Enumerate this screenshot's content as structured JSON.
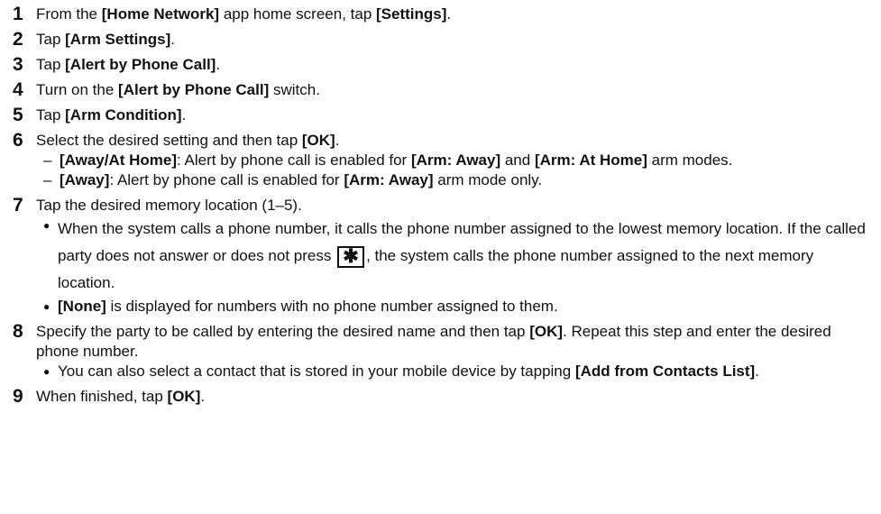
{
  "steps": [
    {
      "num": "1",
      "parts": [
        "From the ",
        "[Home Network]",
        " app home screen, tap ",
        "[Settings]",
        "."
      ]
    },
    {
      "num": "2",
      "parts": [
        "Tap ",
        "[Arm Settings]",
        "."
      ]
    },
    {
      "num": "3",
      "parts": [
        "Tap ",
        "[Alert by Phone Call]",
        "."
      ]
    },
    {
      "num": "4",
      "parts": [
        "Turn on the ",
        "[Alert by Phone Call]",
        " switch."
      ]
    },
    {
      "num": "5",
      "parts": [
        "Tap ",
        "[Arm Condition]",
        "."
      ]
    },
    {
      "num": "6",
      "parts": [
        "Select the desired setting and then tap ",
        "[OK]",
        "."
      ],
      "subs": [
        {
          "marker": "–",
          "parts": [
            "[Away/At Home]",
            ": Alert by phone call is enabled for ",
            "[Arm: Away]",
            " and ",
            "[Arm: At Home]",
            " arm modes."
          ]
        },
        {
          "marker": "–",
          "parts": [
            "[Away]",
            ": Alert by phone call is enabled for ",
            "[Arm: Away]",
            " arm mode only."
          ]
        }
      ]
    },
    {
      "num": "7",
      "parts": [
        "Tap the desired memory location (1–5)."
      ],
      "subs": [
        {
          "marker": "●",
          "parts": [
            "When the system calls a phone number, it calls the phone number assigned to the lowest memory location. If the called party does not answer or does not press ",
            "KEY",
            ", the system calls the phone number assigned to the next memory location."
          ]
        },
        {
          "marker": "●",
          "parts": [
            "[None]",
            " is displayed for numbers with no phone number assigned to them."
          ]
        }
      ]
    },
    {
      "num": "8",
      "parts": [
        "Specify the party to be called by entering the desired name and then tap ",
        "[OK]",
        ". Repeat this step and enter the desired phone number."
      ],
      "subs": [
        {
          "marker": "●",
          "parts": [
            "You can also select a contact that is stored in your mobile device by tapping ",
            "[Add from Contacts List]",
            "."
          ]
        }
      ]
    },
    {
      "num": "9",
      "parts": [
        "When finished, tap ",
        "[OK]",
        "."
      ]
    }
  ],
  "icons": {
    "star_key": "✱"
  }
}
